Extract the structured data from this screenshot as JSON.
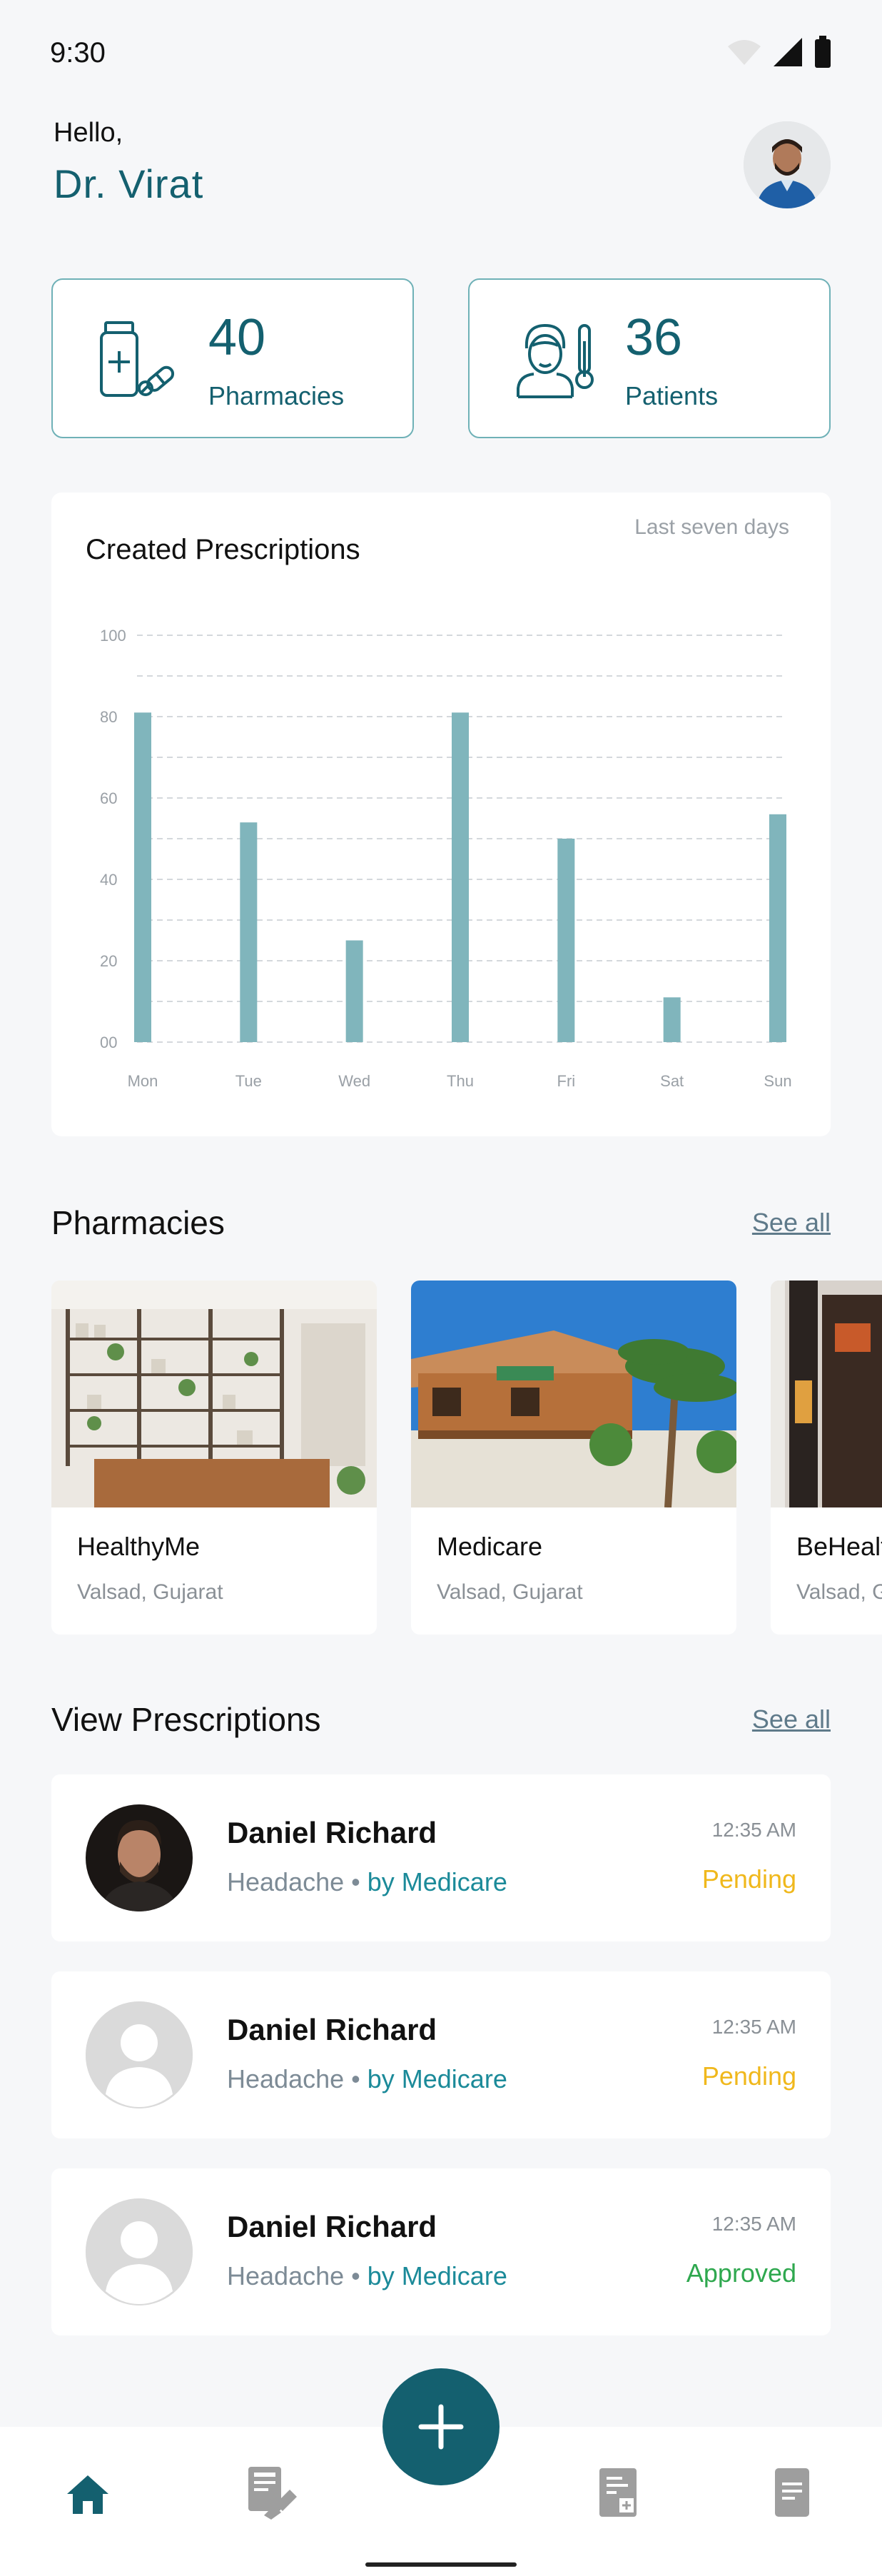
{
  "status_bar": {
    "time": "9:30"
  },
  "header": {
    "greeting": "Hello,",
    "doctor_name": "Dr. Virat"
  },
  "stats": [
    {
      "value": "40",
      "label": "Pharmacies",
      "icon": "pills-bottle-icon"
    },
    {
      "value": "36",
      "label": "Patients",
      "icon": "patient-thermometer-icon"
    }
  ],
  "chart_card": {
    "title": "Created Prescriptions",
    "range_label": "Last seven days"
  },
  "chart_data": {
    "type": "bar",
    "categories": [
      "Mon",
      "Tue",
      "Wed",
      "Thu",
      "Fri",
      "Sat",
      "Sun"
    ],
    "values": [
      81,
      54,
      25,
      81,
      50,
      11,
      56
    ],
    "y_ticks": [
      "00",
      "20",
      "40",
      "60",
      "80",
      "100"
    ],
    "ylim": [
      0,
      100
    ],
    "grid": true,
    "bar_color": "#80b5bc"
  },
  "pharmacies_section": {
    "title": "Pharmacies",
    "see_all": "See all",
    "items": [
      {
        "name": "HealthyMe",
        "location": "Valsad, Gujarat"
      },
      {
        "name": "Medicare",
        "location": "Valsad, Gujarat"
      },
      {
        "name": "BeHealt",
        "location": "Valsad, G"
      }
    ]
  },
  "prescriptions_section": {
    "title": "View Prescriptions",
    "see_all": "See all",
    "items": [
      {
        "name": "Daniel Richard",
        "condition": "Headache",
        "separator": "•",
        "by": "by Medicare",
        "time": "12:35 AM",
        "status": "Pending"
      },
      {
        "name": "Daniel Richard",
        "condition": "Headache",
        "separator": "•",
        "by": "by Medicare",
        "time": "12:35 AM",
        "status": "Pending"
      },
      {
        "name": "Daniel Richard",
        "condition": "Headache",
        "separator": "•",
        "by": "by Medicare",
        "time": "12:35 AM",
        "status": "Approved"
      }
    ]
  },
  "colors": {
    "primary": "#14606f",
    "pending": "#f0b81c",
    "approved": "#2fa84f",
    "nav_inactive": "#9e9e9e"
  },
  "bottom_nav": {
    "items": [
      "home-icon",
      "prescription-edit-icon",
      "document-add-icon",
      "document-icon"
    ],
    "fab_icon": "plus-icon",
    "fab_label": "+"
  }
}
